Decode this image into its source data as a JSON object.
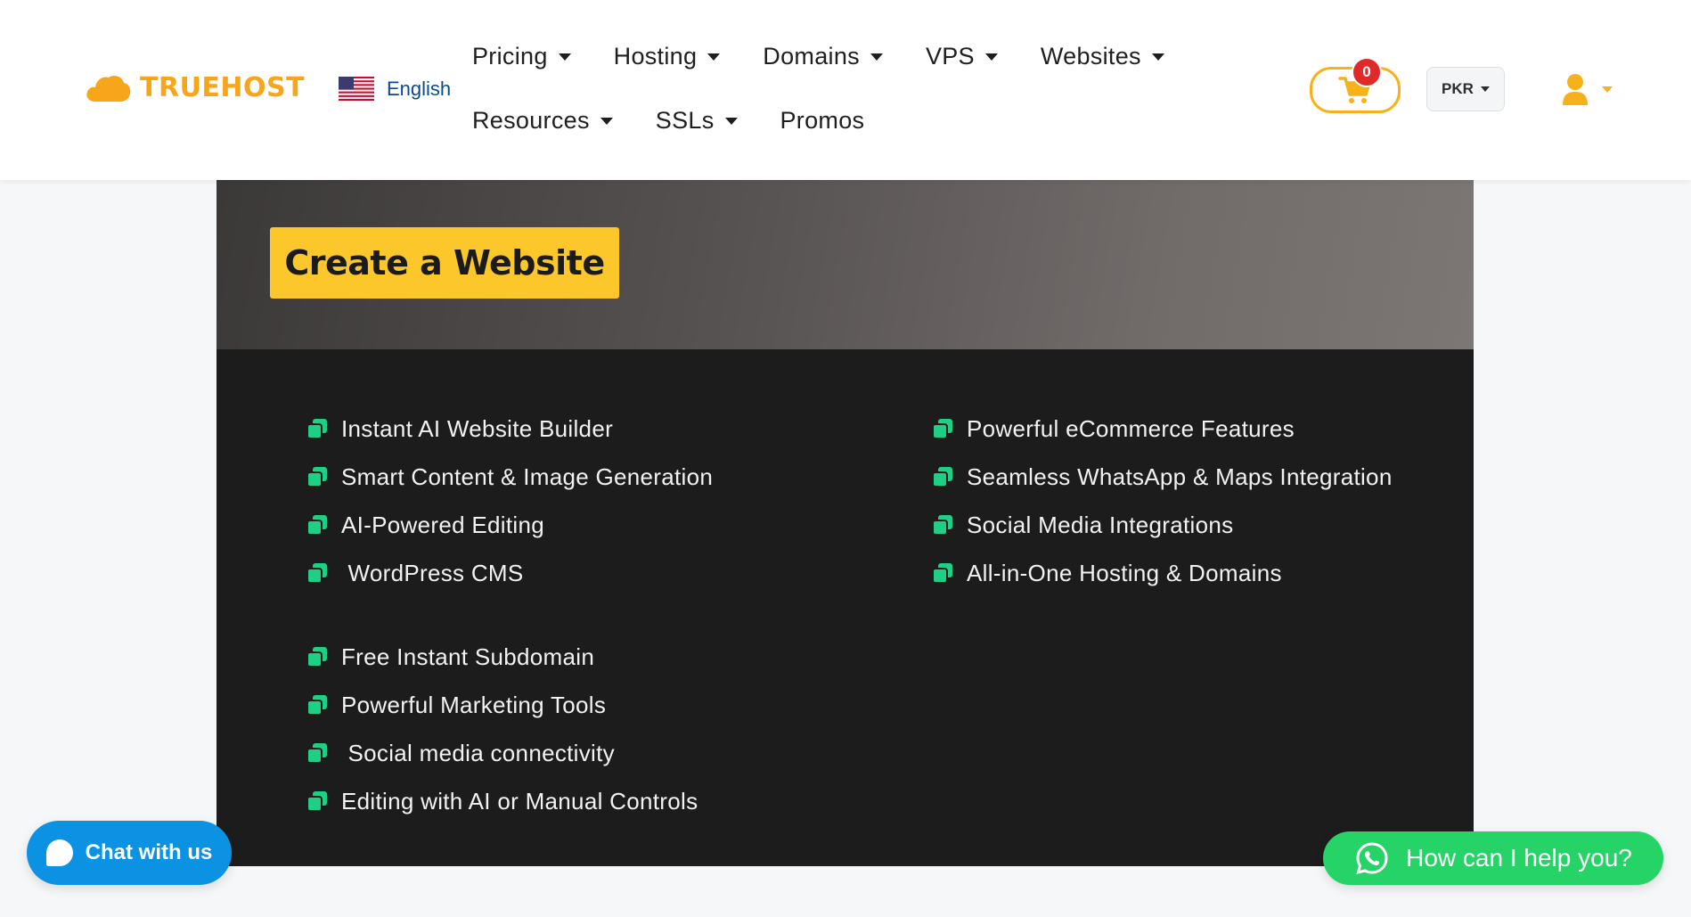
{
  "brand": {
    "name": "TRUEHOST",
    "accent": "#f7a51b"
  },
  "language": {
    "label": "English",
    "flag": "us-flag-icon"
  },
  "nav": {
    "row1": [
      {
        "label": "Pricing",
        "dropdown": true
      },
      {
        "label": "Hosting",
        "dropdown": true
      },
      {
        "label": "Domains",
        "dropdown": true
      },
      {
        "label": "VPS",
        "dropdown": true
      },
      {
        "label": "Websites",
        "dropdown": true
      }
    ],
    "row2": [
      {
        "label": "Resources",
        "dropdown": true
      },
      {
        "label": "SSLs",
        "dropdown": true
      },
      {
        "label": "Promos",
        "dropdown": false
      }
    ]
  },
  "cart": {
    "count": "0",
    "icon": "shopping-cart-icon"
  },
  "currency": {
    "selected": "PKR"
  },
  "account": {
    "icon": "user-icon"
  },
  "hero": {
    "cta_label": "Create a Website",
    "cta_color": "#fcc72b"
  },
  "features": {
    "left_group1": [
      "Instant AI Website Builder",
      "Smart Content & Image Generation",
      "AI-Powered Editing",
      " WordPress CMS"
    ],
    "left_group2": [
      "Free Instant Subdomain",
      "Powerful Marketing Tools",
      " Social media connectivity",
      "Editing with AI or Manual Controls"
    ],
    "right": [
      "Powerful eCommerce Features",
      "Seamless WhatsApp & Maps Integration",
      "Social Media Integrations",
      "All-in-One Hosting & Domains"
    ],
    "bullet_color": "#1fcf86"
  },
  "chat": {
    "label": "Chat with us",
    "color": "#0b92e3"
  },
  "whatsapp": {
    "label": "How can I help you?",
    "color": "#25d366"
  }
}
